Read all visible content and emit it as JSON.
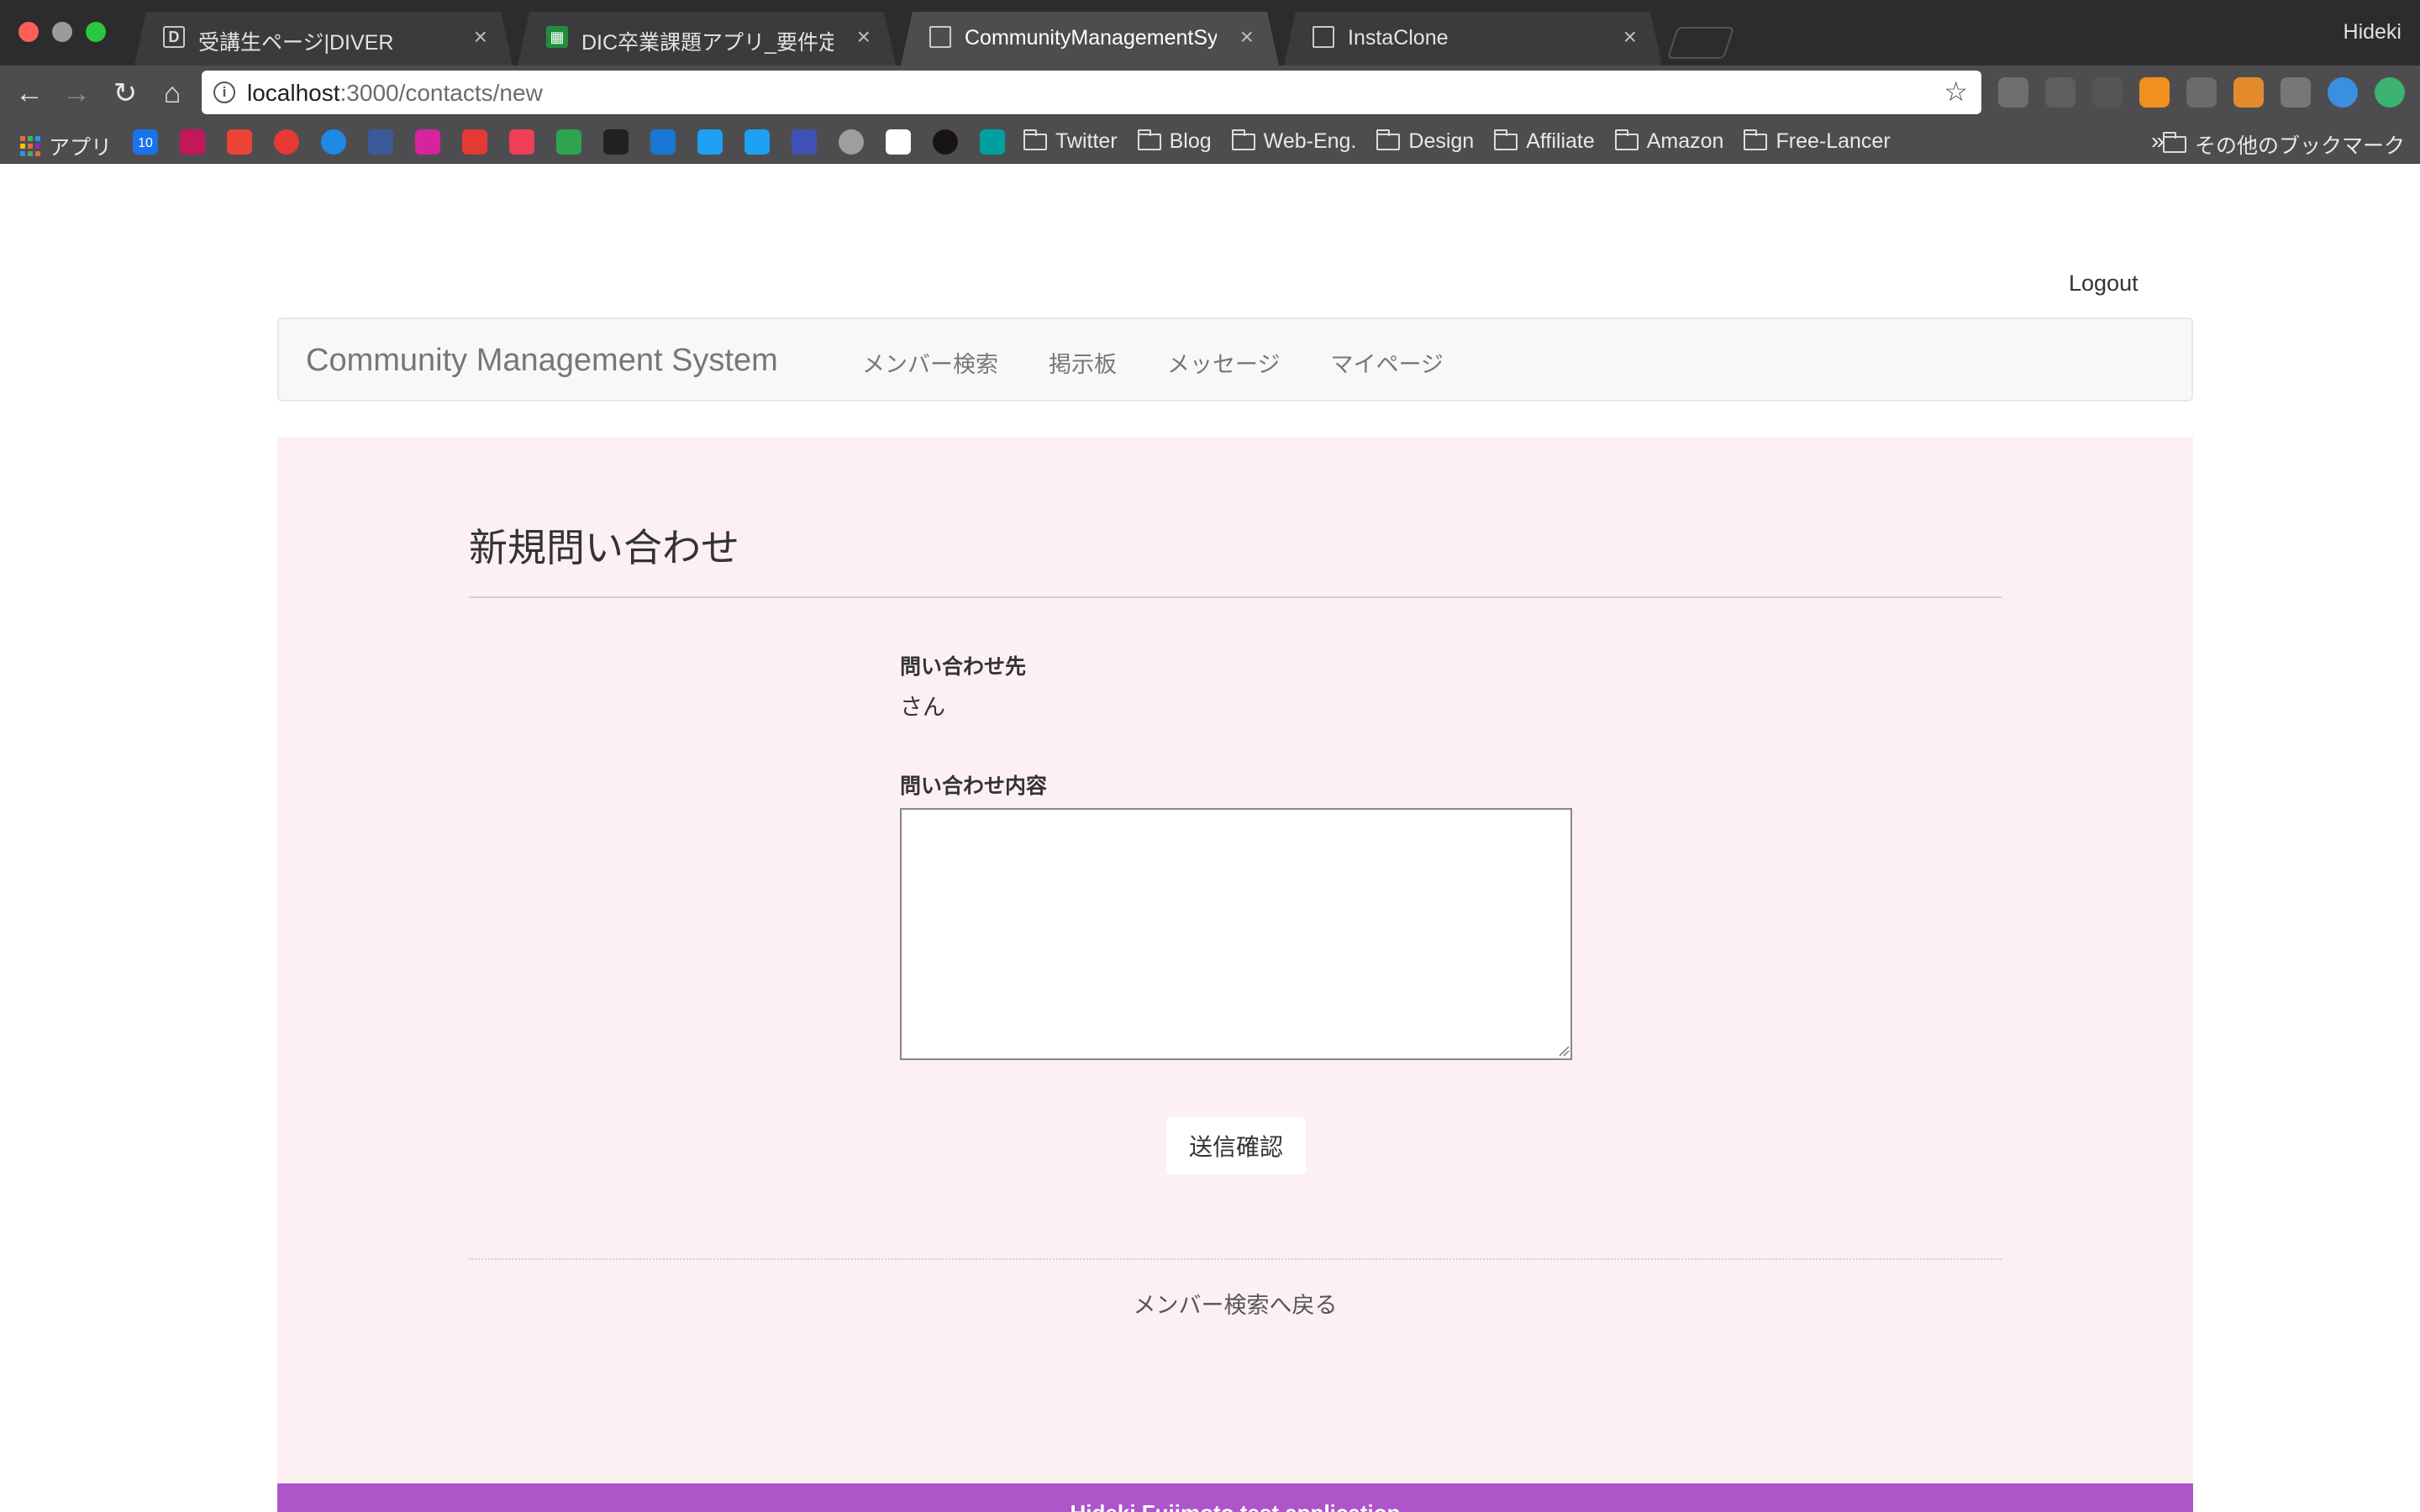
{
  "browser": {
    "tabs": [
      {
        "title": "受講生ページ|DIVER",
        "favicon": "D"
      },
      {
        "title": "DIC卒業課題アプリ_要件定義 - Go"
      },
      {
        "title": "CommunityManagementSystem"
      },
      {
        "title": "InstaClone"
      }
    ],
    "profile_name": "Hideki",
    "url_host": "localhost",
    "url_path": ":3000/contacts/new",
    "bookmarks": {
      "apps_label": "アプリ",
      "calendar_label": "10",
      "folders": [
        "Twitter",
        "Blog",
        "Web-Eng.",
        "Design",
        "Affiliate",
        "Amazon",
        "Free-Lancer"
      ],
      "more": "»",
      "other_label": "その他のブックマーク"
    }
  },
  "page": {
    "logout": "Logout",
    "brand": "Community Management System",
    "nav": [
      "メンバー検索",
      "掲示板",
      "メッセージ",
      "マイページ"
    ],
    "title": "新規問い合わせ",
    "recipient_label": "問い合わせ先",
    "recipient_value": "さん",
    "content_label": "問い合わせ内容",
    "content_value": "",
    "submit_label": "送信確認",
    "back_link": "メンバー検索へ戻る",
    "footer": "Hideki Fujimoto test application"
  },
  "colors": {
    "panel_bg": "#fcf0f3",
    "footer_bg": "#ad55c9",
    "navbar_bg": "#f8f8f8"
  }
}
